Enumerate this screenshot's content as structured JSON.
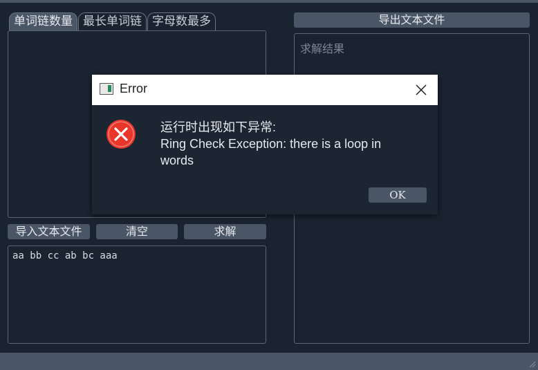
{
  "tabs": [
    {
      "label": "单词链数量",
      "active": true
    },
    {
      "label": "最长单词链",
      "active": false
    },
    {
      "label": "字母数最多",
      "active": false
    }
  ],
  "buttons": {
    "export": "导出文本文件",
    "import": "导入文本文件",
    "clear": "清空",
    "solve": "求解"
  },
  "result_panel": {
    "placeholder": "求解结果"
  },
  "input_area": {
    "value": "aa bb cc ab bc aaa"
  },
  "dialog": {
    "title": "Error",
    "message_line1": "运行时出现如下异常:",
    "message_line2": "Ring Check Exception: there is a loop in words",
    "ok_label": "OK",
    "icons": {
      "app": "app-window-icon",
      "close": "close-icon",
      "error": "error-icon"
    }
  },
  "colors": {
    "background": "#1a2330",
    "button": "#4a5566",
    "error": "#e8372a",
    "dialog_titlebar": "#ffffff"
  }
}
